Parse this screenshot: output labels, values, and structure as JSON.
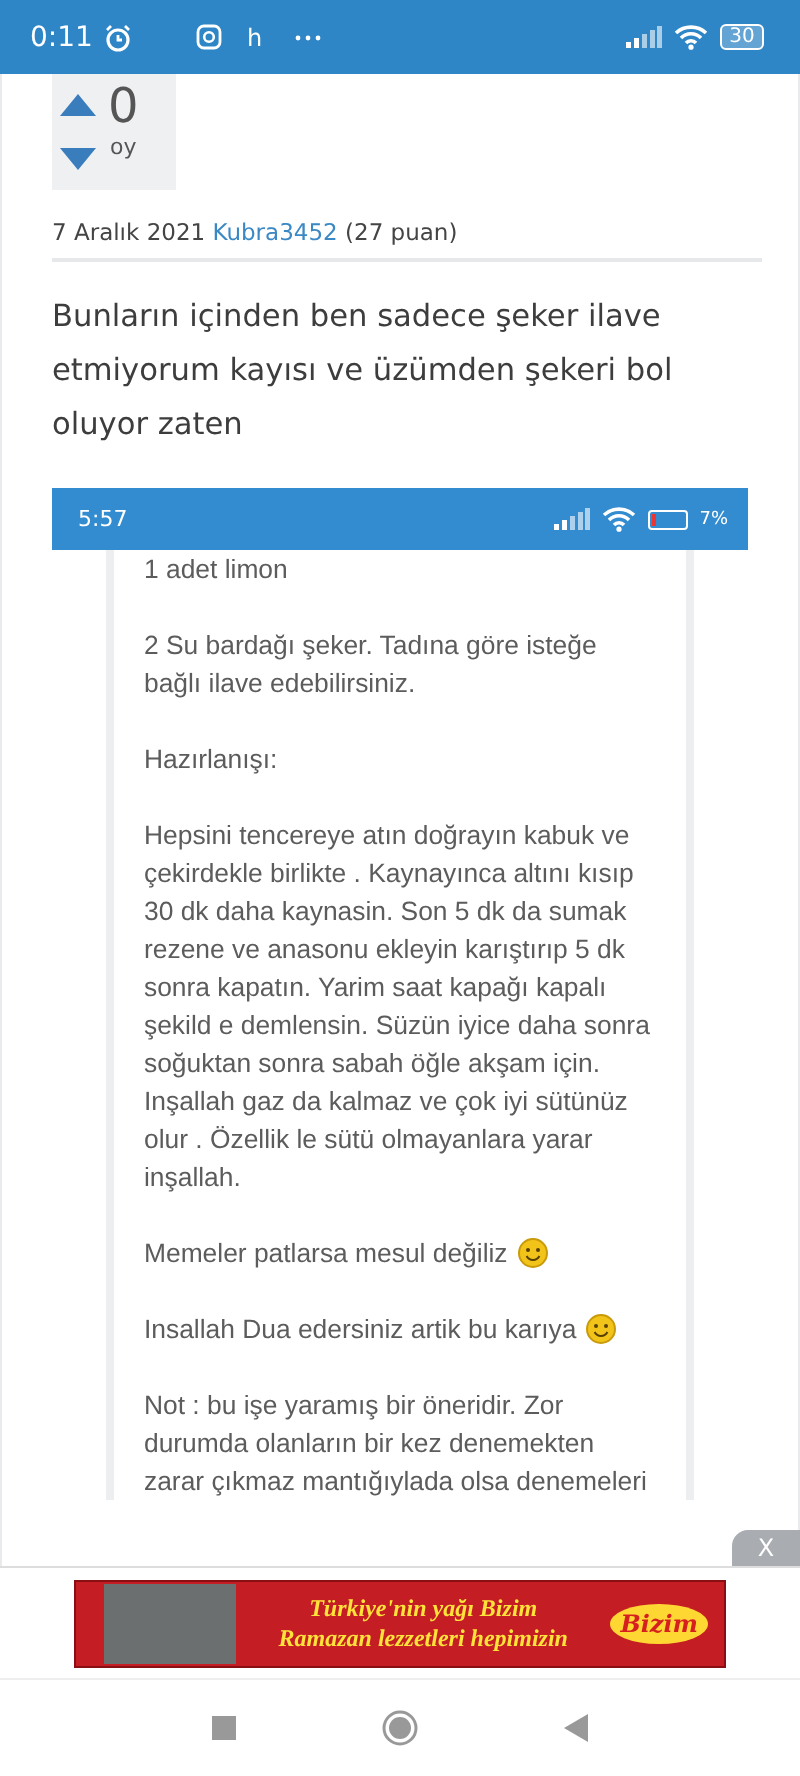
{
  "status_bar": {
    "time": "0:11",
    "app_letter": "h",
    "battery": "30"
  },
  "vote": {
    "count": "0",
    "unit": "oy"
  },
  "meta": {
    "date": "7 Aralık 2021",
    "user": "Kubra3452",
    "points": "(27 puan)"
  },
  "post": {
    "text": "Bunların içinden ben sadece şeker ilave etmiyorum kayısı ve üzümden şekeri bol oluyor zaten"
  },
  "screenshot": {
    "status_bar": {
      "time": "5:57",
      "battery": "7%"
    },
    "paragraphs": [
      {
        "text": "1 adet limon",
        "emoji": false
      },
      {
        "text": "2 Su bardağı şeker.  Tadına göre isteğe bağlı ilave edebilirsiniz.",
        "emoji": false
      },
      {
        "text": "Hazırlanışı:",
        "emoji": false
      },
      {
        "text": "Hepsini tencereye atın doğrayın kabuk ve çekirdekle birlikte . Kaynayınca altını kısıp 30 dk daha kaynasin. Son 5 dk da sumak rezene ve anasonu ekleyin karıştırıp 5 dk sonra kapatın.  Yarim saat kapağı kapalı şekild e demlensin.  Süzün iyice daha sonra soğuktan sonra sabah öğle akşam için. Inşallah gaz da kalmaz ve çok iyi sütünüz olur . Özellik le sütü olmayanlara yarar inşallah.",
        "emoji": false
      },
      {
        "text": "Memeler patlarsa mesul değiliz",
        "emoji": true
      },
      {
        "text": "Insallah Dua edersiniz artik bu karıya",
        "emoji": true
      },
      {
        "text": "Not : bu işe yaramış bir öneridir.  Zor durumda olanların bir kez denemekten zarar çıkmaz mantığıylada olsa denemeleri",
        "emoji": false
      }
    ]
  },
  "ad": {
    "close": "X",
    "line_1": "Türkiye'nin yağı Bizim",
    "line_2": "Ramazan lezzetleri hepimizin",
    "logo": "Bizim"
  }
}
